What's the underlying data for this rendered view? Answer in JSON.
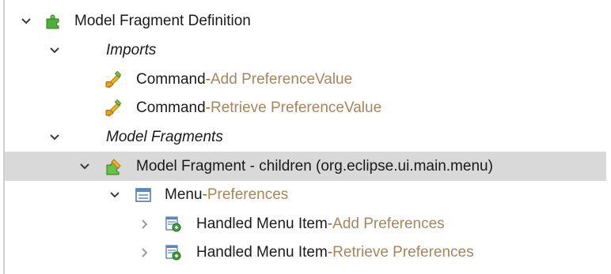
{
  "tree": {
    "root": {
      "label": "Model Fragment Definition",
      "icon": "puzzle-icon",
      "expanded": true
    },
    "imports": {
      "label": "Imports",
      "expanded": true,
      "items": [
        {
          "type": "Command",
          "sep": " - ",
          "detail": "Add PreferenceValue",
          "icon": "command-icon"
        },
        {
          "type": "Command",
          "sep": " - ",
          "detail": "Retrieve PreferenceValue",
          "icon": "command-icon"
        }
      ]
    },
    "model_fragments": {
      "label": "Model Fragments",
      "expanded": true
    },
    "fragment": {
      "label": "Model Fragment - children (org.eclipse.ui.main.menu)",
      "icon": "model-fragment-icon",
      "expanded": true,
      "selected": true
    },
    "menu": {
      "type": "Menu",
      "sep": " - ",
      "detail": "Preferences",
      "icon": "menu-icon",
      "expanded": true
    },
    "menu_items": [
      {
        "type": "Handled Menu Item",
        "sep": " - ",
        "detail": "Add Preferences",
        "icon": "handled-menu-item-icon",
        "expanded": false
      },
      {
        "type": "Handled Menu Item",
        "sep": " - ",
        "detail": "Retrieve Preferences",
        "icon": "handled-menu-item-icon",
        "expanded": false
      }
    ]
  },
  "colors": {
    "selection_bg": "#d9d9d9",
    "detail_text": "#a8855a",
    "main_text": "#1a1a1a"
  }
}
